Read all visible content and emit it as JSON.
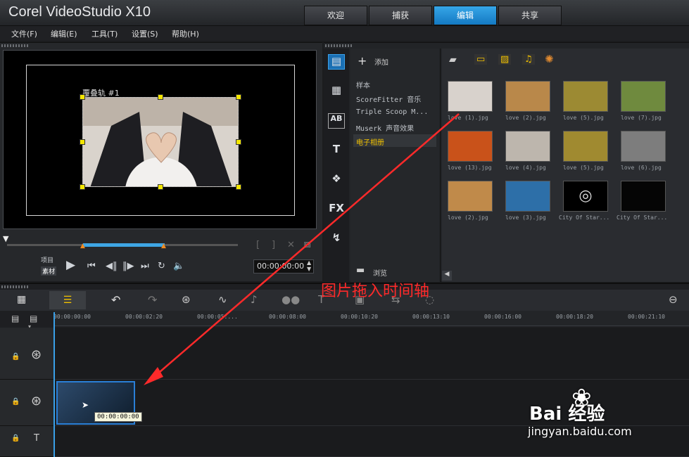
{
  "app": {
    "title": "Corel VideoStudio X10"
  },
  "tabs": [
    {
      "label": "欢迎"
    },
    {
      "label": "捕获"
    },
    {
      "label": "编辑"
    },
    {
      "label": "共享"
    }
  ],
  "menu": [
    {
      "label": "文件(F)"
    },
    {
      "label": "编辑(E)"
    },
    {
      "label": "工具(T)"
    },
    {
      "label": "设置(S)"
    },
    {
      "label": "帮助(H)"
    }
  ],
  "preview": {
    "overlay_label": "覆叠轨 #1",
    "mode_project": "项目",
    "mode_clip": "素材",
    "timecode": "00:00:00:00"
  },
  "library": {
    "add_label": "添加",
    "browse_label": "浏览",
    "folders": [
      {
        "label": "样本"
      },
      {
        "label": "ScoreFitter 音乐"
      },
      {
        "label": "Triple Scoop M..."
      },
      {
        "label": "Muserk 声音效果"
      },
      {
        "label": "电子相册"
      }
    ],
    "side_icons": [
      "media-icon",
      "instant-project-icon",
      "transition-icon",
      "title-icon",
      "graphic-icon",
      "fx-icon",
      "path-icon"
    ],
    "items": [
      {
        "label": "love (1).jpg",
        "color": "#d8d2cc"
      },
      {
        "label": "love (2).jpg",
        "color": "#b9884a"
      },
      {
        "label": "love (5).jpg",
        "color": "#9c8a33"
      },
      {
        "label": "love (7).jpg",
        "color": "#6f8a3e"
      },
      {
        "label": "love (13).jpg",
        "color": "#c9521a"
      },
      {
        "label": "love (4).jpg",
        "color": "#bdb6ad"
      },
      {
        "label": "love (5).jpg",
        "color": "#a08a30"
      },
      {
        "label": "love (6).jpg",
        "color": "#7d7d7d"
      },
      {
        "label": "love (2).jpg",
        "color": "#c08a4a"
      },
      {
        "label": "love (3).jpg",
        "color": "#2d6fa8"
      },
      {
        "label": "City Of Star...",
        "color": "#000000"
      },
      {
        "label": "City Of Star...",
        "color": "#050505"
      }
    ]
  },
  "timeline": {
    "ticks": [
      "00:00:00:00",
      "00:00:02:20",
      "00:00:05:...",
      "00:00:08:00",
      "00:00:10:20",
      "00:00:13:10",
      "00:00:16:00",
      "00:00:18:20",
      "00:00:21:10"
    ],
    "clip_time": "00:00:00:00"
  },
  "annotation": "图片拖入时间轴",
  "watermark": {
    "brand": "Bai 经验",
    "url": "jingyan.baidu.com"
  }
}
